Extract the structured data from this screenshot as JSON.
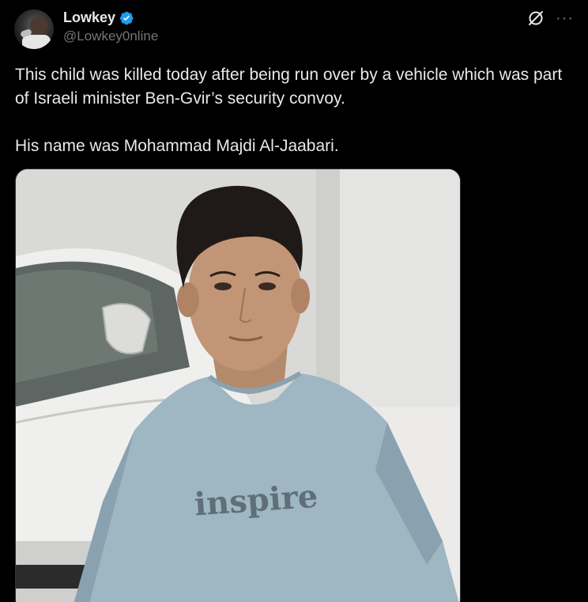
{
  "author": {
    "display_name": "Lowkey",
    "handle": "@Lowkey0nline",
    "verified": true
  },
  "icons": {
    "avatar": "user-avatar",
    "verified": "verified-badge-icon",
    "grok": "grok-icon",
    "more": "more-options-icon"
  },
  "colors": {
    "background": "#000000",
    "text": "#e7e9ea",
    "secondary": "#71767b",
    "verified": "#1d9bf0"
  },
  "tweet": {
    "line1": "This child was killed today after being run over by a vehicle which was part of Israeli minister Ben-Gvir’s security convoy.",
    "line2": "His name was Mohammad Majdi Al-Jaabari."
  },
  "media": {
    "shirt_text": "inspire"
  }
}
